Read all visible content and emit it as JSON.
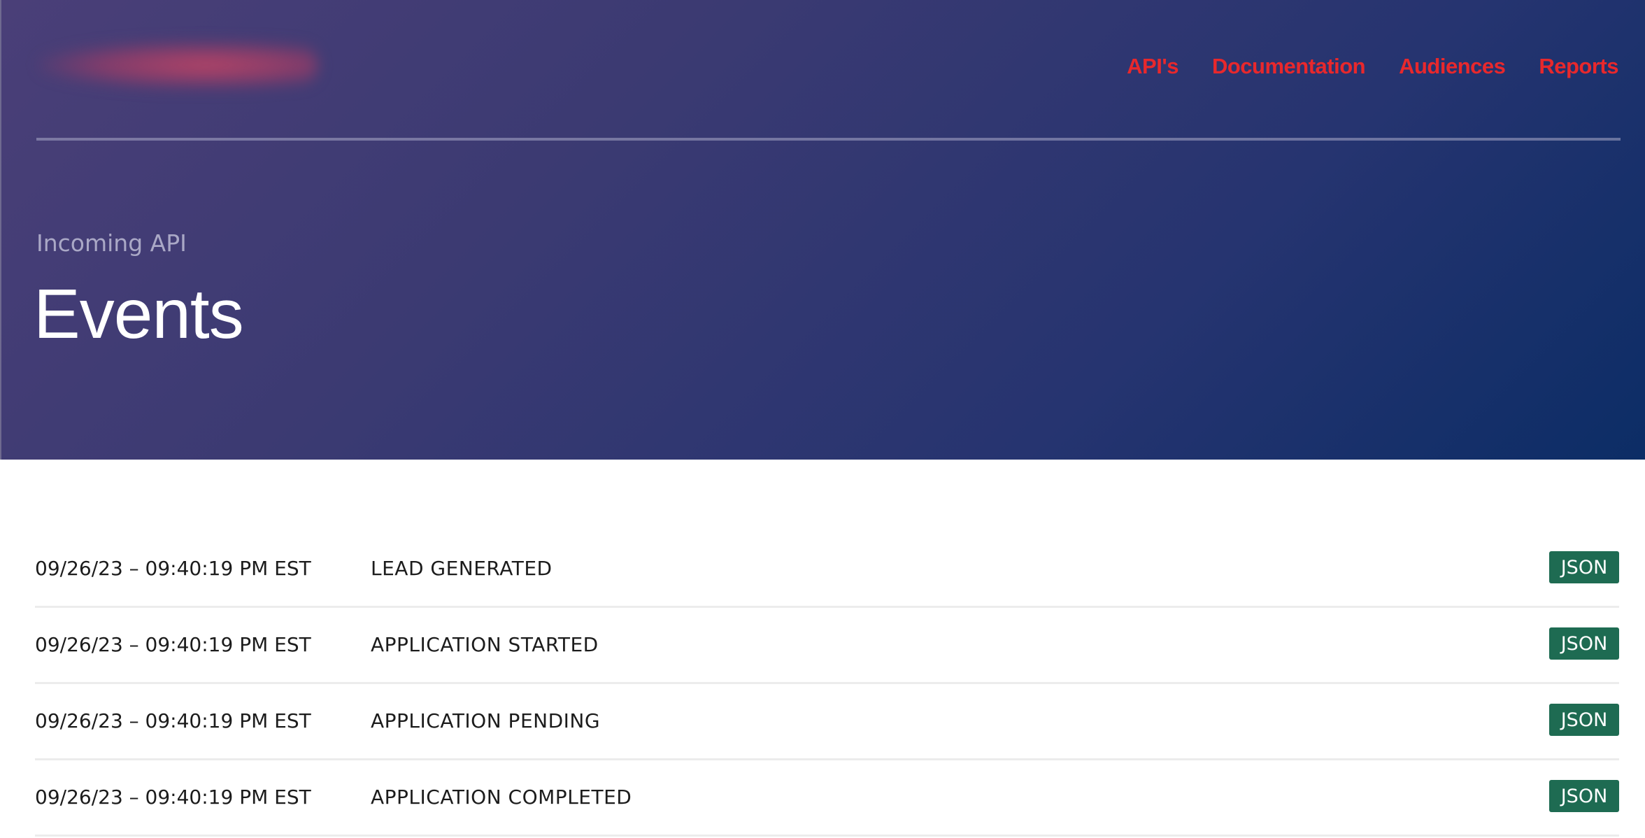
{
  "header": {
    "logo": "blurred-logo",
    "nav": [
      {
        "label": "API's"
      },
      {
        "label": "Documentation"
      },
      {
        "label": "Audiences"
      },
      {
        "label": "Reports"
      }
    ],
    "link_color": "#e8282c",
    "background_start": "#4a3f78",
    "background_end": "#0c2d66"
  },
  "hero": {
    "eyebrow": "Incoming API",
    "title": "Events"
  },
  "events": {
    "button_color": "#1e6b52",
    "rows": [
      {
        "timestamp": "09/26/23 – 09:40:19 PM EST",
        "event": "LEAD GENERATED",
        "action": "JSON"
      },
      {
        "timestamp": "09/26/23 – 09:40:19 PM EST",
        "event": "APPLICATION STARTED",
        "action": "JSON"
      },
      {
        "timestamp": "09/26/23 – 09:40:19 PM EST",
        "event": "APPLICATION PENDING",
        "action": "JSON"
      },
      {
        "timestamp": "09/26/23 – 09:40:19 PM EST",
        "event": "APPLICATION COMPLETED",
        "action": "JSON"
      }
    ]
  }
}
